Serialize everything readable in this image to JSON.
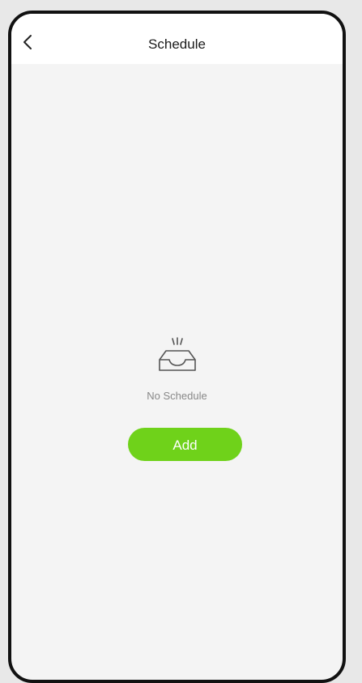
{
  "header": {
    "title": "Schedule"
  },
  "icons": {
    "back": "chevron-left-icon",
    "empty": "empty-inbox-tray-icon"
  },
  "empty_state": {
    "message": "No Schedule"
  },
  "actions": {
    "add_label": "Add"
  },
  "colors": {
    "accent": "#6fd21a",
    "background": "#f4f4f4",
    "header_background": "#ffffff"
  }
}
